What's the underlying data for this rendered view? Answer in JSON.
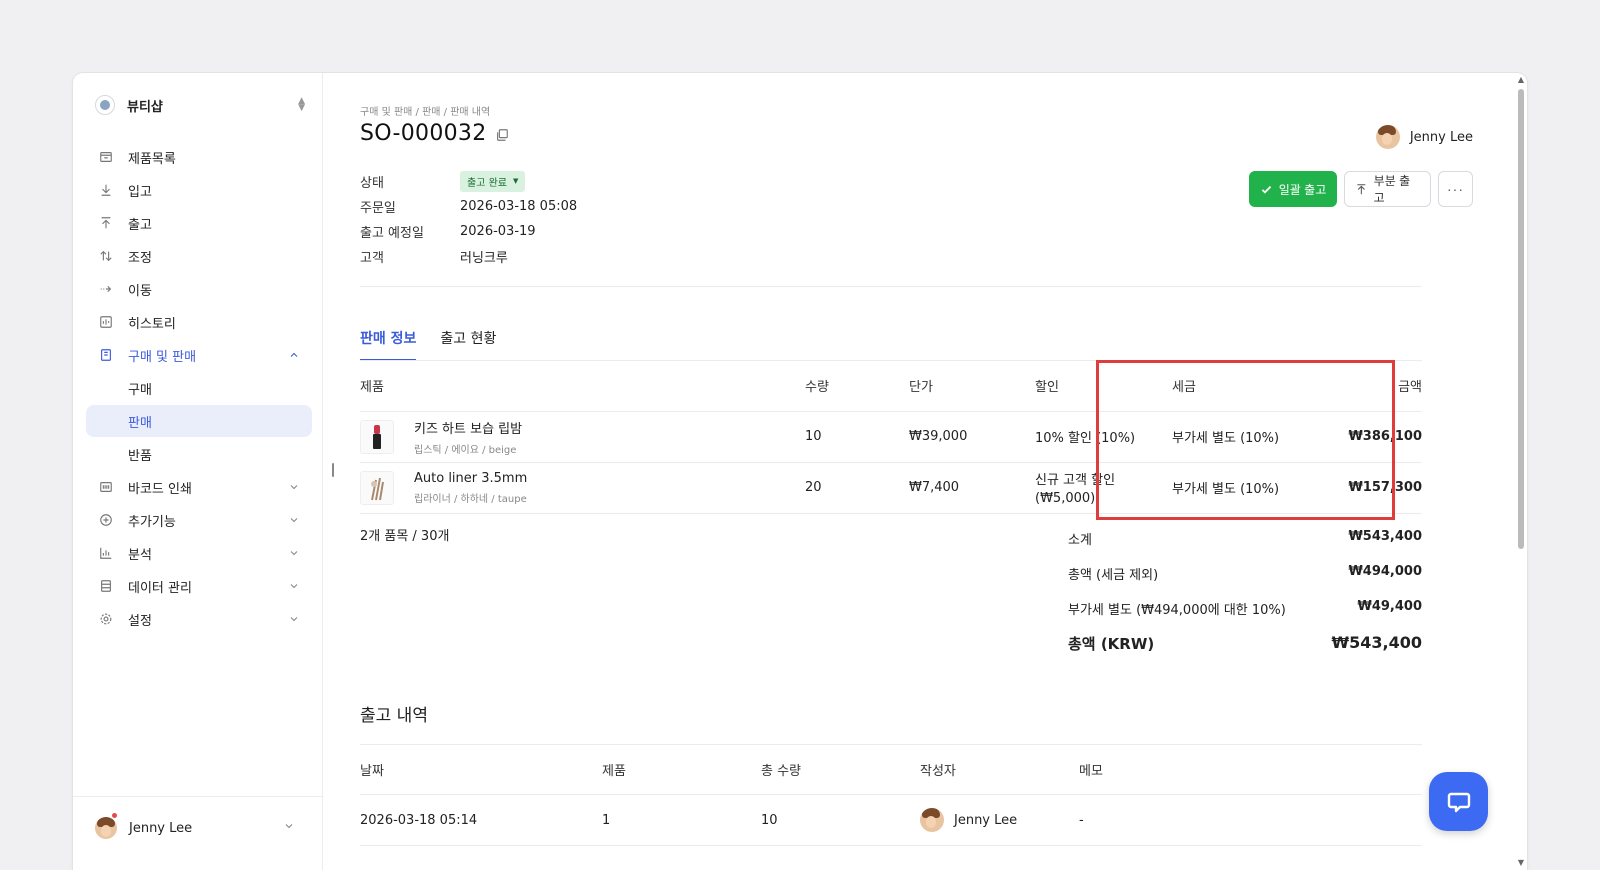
{
  "colors": {
    "accent": "#3b5bdb",
    "primary_button": "#22b24c",
    "highlight_box": "#e03c3c",
    "badge_bg": "#d9f2df",
    "chat_button": "#3d6af2"
  },
  "sidebar": {
    "workspace": "뷰티샵",
    "items": [
      {
        "label": "제품목록",
        "icon": "box-icon"
      },
      {
        "label": "입고",
        "icon": "arrow-down-icon"
      },
      {
        "label": "출고",
        "icon": "arrow-up-icon"
      },
      {
        "label": "조정",
        "icon": "swap-icon"
      },
      {
        "label": "이동",
        "icon": "arrow-right-icon"
      },
      {
        "label": "히스토리",
        "icon": "history-icon"
      },
      {
        "label": "구매 및 판매",
        "icon": "document-icon",
        "expanded": true
      },
      {
        "label": "구매"
      },
      {
        "label": "판매",
        "selected": true
      },
      {
        "label": "반품"
      },
      {
        "label": "바코드 인쇄",
        "icon": "barcode-icon"
      },
      {
        "label": "추가기능",
        "icon": "plus-circle-icon"
      },
      {
        "label": "분석",
        "icon": "chart-icon"
      },
      {
        "label": "데이터 관리",
        "icon": "database-icon"
      },
      {
        "label": "설정",
        "icon": "gear-icon"
      }
    ],
    "user": "Jenny Lee"
  },
  "header": {
    "breadcrumb": "구매 및 판매 / 판매 / 판매 내역",
    "title": "SO-000032",
    "user": "Jenny Lee",
    "buttons": {
      "ship_all": "일괄 출고",
      "partial_ship": "부분 출고",
      "more": "···"
    }
  },
  "info": {
    "status_label": "상태",
    "status_value": "출고 완료",
    "order_date_label": "주문일",
    "order_date_value": "2026-03-18 05:08",
    "ship_date_label": "출고 예정일",
    "ship_date_value": "2026-03-19",
    "customer_label": "고객",
    "customer_value": "러닝크루"
  },
  "tabs": [
    "판매 정보",
    "출고 현황"
  ],
  "items_table": {
    "headers": {
      "product": "제품",
      "qty": "수량",
      "price": "단가",
      "discount": "할인",
      "tax": "세금",
      "amount": "금액"
    },
    "rows": [
      {
        "name": "키즈 하트 보습 립밤",
        "variant": "립스틱 / 에이요 / beige",
        "qty": "10",
        "price": "₩39,000",
        "discount": "10% 할인 (10%)",
        "tax": "부가세 별도 (10%)",
        "amount": "₩386,100"
      },
      {
        "name": "Auto liner 3.5mm",
        "variant": "립라이너 / 하하네 / taupe",
        "qty": "20",
        "price": "₩7,400",
        "discount_line1": "신규 고객 할인",
        "discount_line2": "(₩5,000)",
        "tax": "부가세 별도 (10%)",
        "amount": "₩157,300"
      }
    ],
    "count": "2개 품목 / 30개"
  },
  "summary": {
    "subtotal_label": "소계",
    "subtotal_value": "₩543,400",
    "pretax_label": "총액 (세금 제외)",
    "pretax_value": "₩494,000",
    "vat_label": "부가세 별도 (₩494,000에 대한 10%)",
    "vat_value": "₩49,400",
    "total_label": "총액 (KRW)",
    "total_value": "₩543,400"
  },
  "shipments": {
    "title": "출고 내역",
    "headers": {
      "date": "날짜",
      "product": "제품",
      "total_qty": "총 수량",
      "author": "작성자",
      "memo": "메모"
    },
    "rows": [
      {
        "date": "2026-03-18 05:14",
        "product": "1",
        "total_qty": "10",
        "author": "Jenny Lee",
        "memo": "-"
      }
    ]
  }
}
